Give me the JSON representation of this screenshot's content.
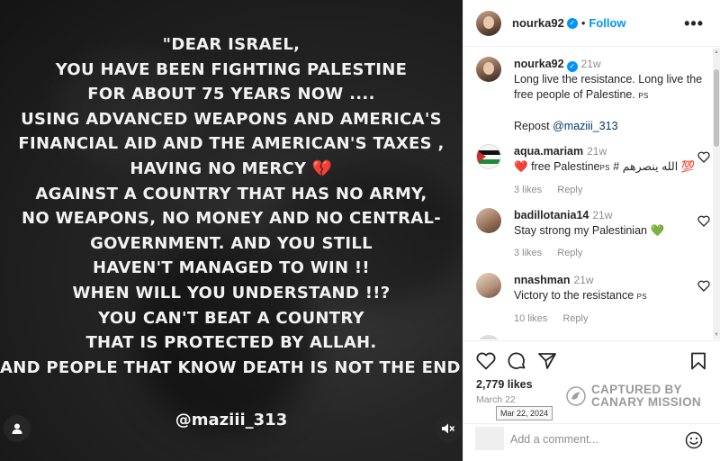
{
  "media": {
    "quote_lines": [
      "\"DEAR ISRAEL,",
      "YOU HAVE BEEN FIGHTING PALESTINE",
      "FOR ABOUT 75 YEARS NOW ....",
      "USING ADVANCED WEAPONS AND AMERICA'S",
      "FINANCIAL AID AND THE AMERICAN'S TAXES ,",
      "HAVING NO MERCY",
      "AGAINST A COUNTRY THAT HAS NO ARMY,",
      "NO WEAPONS, NO MONEY AND NO CENTRAL-",
      "GOVERNMENT. AND YOU STILL",
      "HAVEN'T MANAGED TO WIN !!",
      "WHEN WILL YOU UNDERSTAND !!?",
      "YOU CAN'T BEAT A COUNTRY",
      "THAT IS PROTECTED BY ALLAH.",
      "AND PEOPLE THAT KNOW DEATH IS NOT THE END :"
    ],
    "broken_heart": "💔",
    "handle": "@maziii_313",
    "icons": {
      "user": "user-tag-icon",
      "mute": "mute-icon"
    }
  },
  "header": {
    "username": "nourka92",
    "separator": "•",
    "follow_label": "Follow",
    "more_label": "•••"
  },
  "caption": {
    "username": "nourka92",
    "time": "21w",
    "text": "Long live the resistance. Long live the free people of Palestine.",
    "flag_emoji": "PS",
    "repost_prefix": "Repost",
    "repost_handle": "@maziii_313"
  },
  "comments": [
    {
      "username": "aqua.mariam",
      "time": "21w",
      "heart": "❤️",
      "text_a": "free Palestine",
      "flag": "PS",
      "text_b": "# الله ينصرهم",
      "emoji_end": "💯",
      "likes": "3 likes",
      "reply": "Reply"
    },
    {
      "username": "badillotania14",
      "time": "21w",
      "text": "Stay strong my Palestinian",
      "emoji_end": "💚",
      "likes": "3 likes",
      "reply": "Reply"
    },
    {
      "username": "nnashman",
      "time": "21w",
      "text": "Victory to the resistance",
      "flag": "PS",
      "likes": "10 likes",
      "reply": "Reply"
    }
  ],
  "stats": {
    "likes": "2,779 likes",
    "date": "March 22",
    "tooltip": "Mar 22, 2024"
  },
  "watermark": {
    "line1": "CAPTURED BY",
    "line2": "CANARY MISSION"
  },
  "add_comment": {
    "placeholder": "Add a comment..."
  },
  "colors": {
    "accent": "#0095f6",
    "verified": "#0095f6",
    "muted": "#8e8e8e"
  }
}
